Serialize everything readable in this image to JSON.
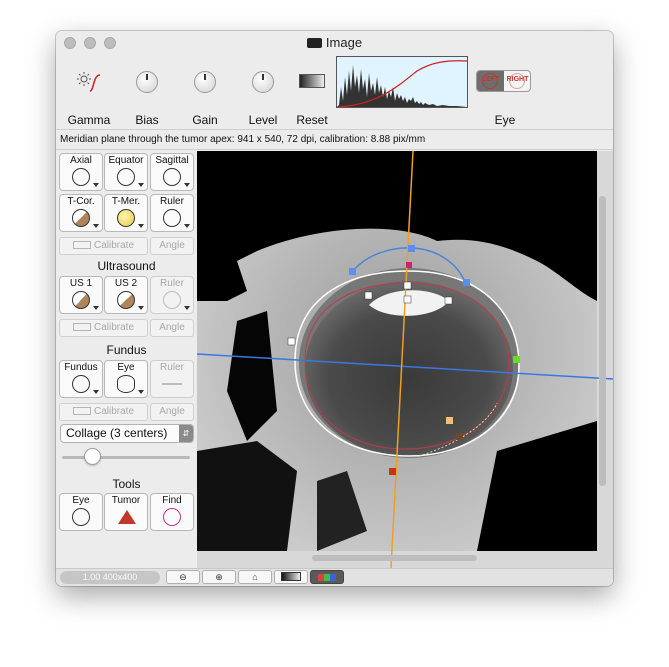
{
  "window": {
    "title": "Image"
  },
  "toolbar": {
    "gamma": "Gamma",
    "bias": "Bias",
    "gain": "Gain",
    "level": "Level",
    "reset": "Reset",
    "eye": "Eye",
    "eye_left": "LEFT",
    "eye_right": "RIGHT"
  },
  "info": {
    "text": "Meridian plane through the tumor apex: 941 x 540, 72 dpi, calibration: 8.88 pix/mm"
  },
  "sidebar": {
    "views": [
      {
        "label": "Axial"
      },
      {
        "label": "Equator"
      },
      {
        "label": "Sagittal"
      },
      {
        "label": "T-Cor."
      },
      {
        "label": "T-Mer."
      },
      {
        "label": "Ruler"
      }
    ],
    "calibrate": "Calibrate",
    "angle": "Angle",
    "ultrasound_title": "Ultrasound",
    "ultrasound": [
      {
        "label": "US 1"
      },
      {
        "label": "US 2"
      },
      {
        "label": "Ruler"
      }
    ],
    "fundus_title": "Fundus",
    "fundus": [
      {
        "label": "Fundus"
      },
      {
        "label": "Eye"
      },
      {
        "label": "Ruler"
      }
    ],
    "collage_select": "Collage (3 centers)",
    "tools_title": "Tools",
    "tools": [
      {
        "label": "Eye"
      },
      {
        "label": "Tumor"
      },
      {
        "label": "Find"
      }
    ]
  },
  "status": {
    "zoom": "1.00 400x400"
  },
  "colors": {
    "accent_orange": "#f0a020",
    "accent_blue": "#3a78e0",
    "contour_blue": "#4a86d8",
    "contour_red": "#c0394b",
    "contour_white": "#ffffff",
    "marker_green": "#66dd22",
    "marker_magenta": "#d02070",
    "marker_red": "#d03010",
    "marker_peach": "#f0c080",
    "marker_brown": "#6b4a30"
  }
}
